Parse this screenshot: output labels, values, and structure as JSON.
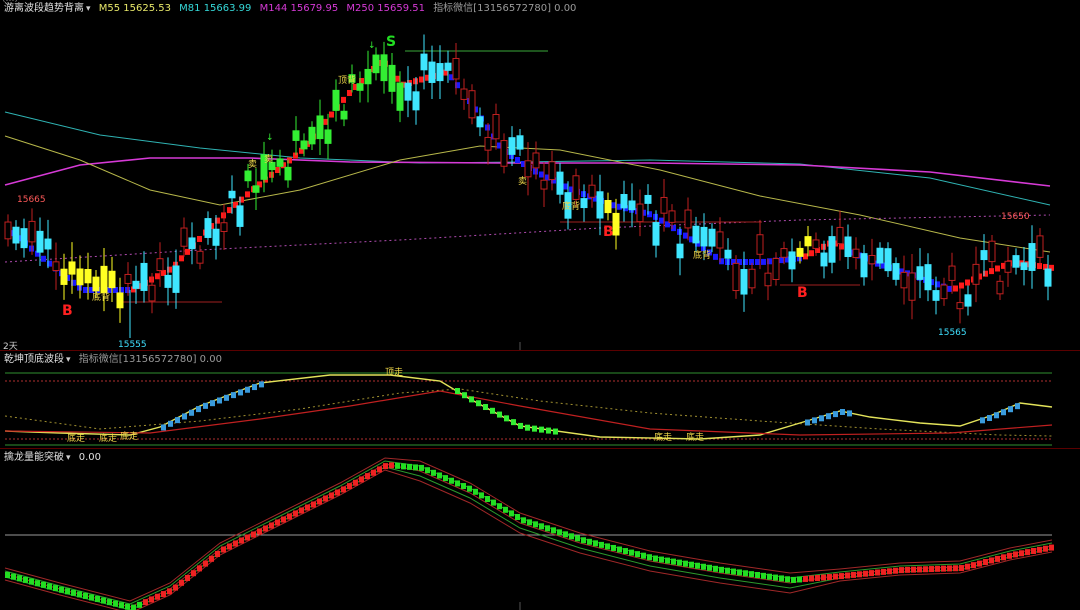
{
  "top_info": "(…) · · ·",
  "panels": {
    "main": {
      "name": "游离波段趋势背离",
      "ma": [
        {
          "label": "M55 15625.53",
          "color": "#e7e76a"
        },
        {
          "label": "M81 15663.99",
          "color": "#35d8d8"
        },
        {
          "label": "M144 15679.95",
          "color": "#d63ad6"
        },
        {
          "label": "M250 15659.51",
          "color": "#d63ad6"
        }
      ],
      "wechat": "指标微信[13156572780] 0.00",
      "bars_label": "2天",
      "price_labels": [
        {
          "text": "15665",
          "color": "#ff5a5a"
        },
        {
          "text": "15555",
          "color": "#3fe0ff"
        },
        {
          "text": "15650",
          "color": "#ff5a5a"
        },
        {
          "text": "15565",
          "color": "#3fe0ff"
        }
      ],
      "signals": [
        {
          "text": "B",
          "color": "#ff2020"
        },
        {
          "text": "S",
          "color": "#22dd22"
        },
        {
          "text": "B",
          "color": "#ff2020"
        },
        {
          "text": "B",
          "color": "#ff2020"
        }
      ],
      "notes": [
        "底背",
        "顶背",
        "卖",
        "卖",
        "卖",
        "底背",
        "底背"
      ]
    },
    "mid": {
      "name": "乾坤顶底波段",
      "wechat": "指标微信[13156572780] 0.00",
      "notes": [
        "底走",
        "底走",
        "底走",
        "顶走",
        "底走",
        "底走"
      ]
    },
    "bottom": {
      "name": "擒龙量能突破",
      "value": "0.00"
    }
  }
}
